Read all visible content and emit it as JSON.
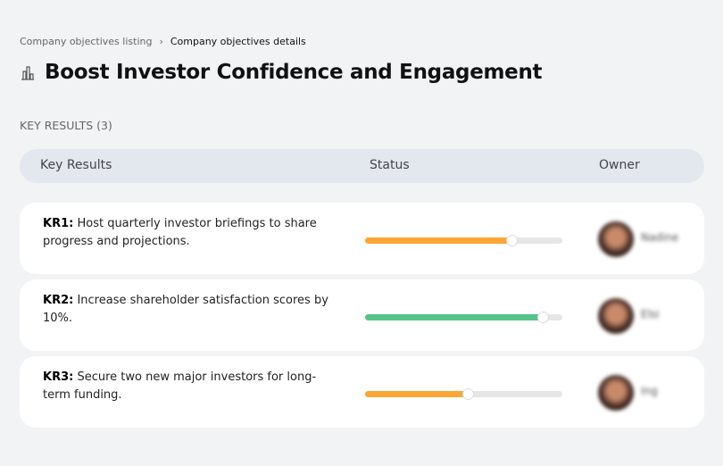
{
  "breadcrumb": {
    "parent": "Company objectives listing",
    "separator": "›",
    "current": "Company objectives details"
  },
  "page": {
    "icon": "building-chart-icon",
    "title": "Boost Investor Confidence and Engagement"
  },
  "key_results_label": "KEY RESULTS (3)",
  "table": {
    "headers": {
      "key_results": "Key Results",
      "status": "Status",
      "owner": "Owner"
    }
  },
  "colors": {
    "orange": "#fba534",
    "green": "#55c48a"
  },
  "rows": [
    {
      "id": "KR1:",
      "text": " Host quarterly investor briefings to share progress and projections.",
      "progress": 74,
      "color": "#fba534",
      "owner": "Nadine"
    },
    {
      "id": "KR2:",
      "text": " Increase shareholder satisfaction scores by 10%.",
      "progress": 90,
      "color": "#55c48a",
      "owner": "Elsi"
    },
    {
      "id": "KR3:",
      "text": " Secure two new major investors for long-term funding.",
      "progress": 52,
      "color": "#fba534",
      "owner": "Ing"
    }
  ]
}
